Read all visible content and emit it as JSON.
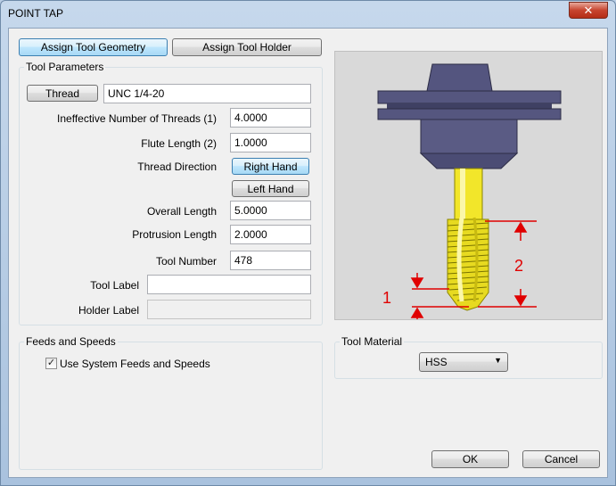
{
  "window": {
    "title": "POINT TAP",
    "close_label": "✕"
  },
  "tabs": {
    "geometry": "Assign Tool Geometry",
    "holder": "Assign Tool Holder"
  },
  "tool_parameters": {
    "group_label": "Tool Parameters",
    "thread_button": "Thread",
    "thread_value": "UNC  1/4-20",
    "ineffective_threads_label": "Ineffective Number of Threads (1)",
    "ineffective_threads_value": "4.0000",
    "flute_length_label": "Flute Length (2)",
    "flute_length_value": "1.0000",
    "thread_direction_label": "Thread Direction",
    "right_hand": "Right Hand",
    "left_hand": "Left Hand",
    "overall_length_label": "Overall Length",
    "overall_length_value": "5.0000",
    "protrusion_length_label": "Protrusion Length",
    "protrusion_length_value": "2.0000",
    "tool_number_label": "Tool Number",
    "tool_number_value": "478",
    "tool_label_label": "Tool Label",
    "tool_label_value": "",
    "holder_label_label": "Holder Label",
    "holder_label_value": ""
  },
  "feeds": {
    "group_label": "Feeds and Speeds",
    "use_system_label": "Use System Feeds and Speeds",
    "checked": true
  },
  "material": {
    "group_label": "Tool Material",
    "selected": "HSS"
  },
  "preview": {
    "dim1_label": "1",
    "dim2_label": "2"
  },
  "footer": {
    "ok": "OK",
    "cancel": "Cancel"
  },
  "colors": {
    "holder": "#54557f",
    "tap": "#f2e62a",
    "dimension": "#e00000"
  }
}
